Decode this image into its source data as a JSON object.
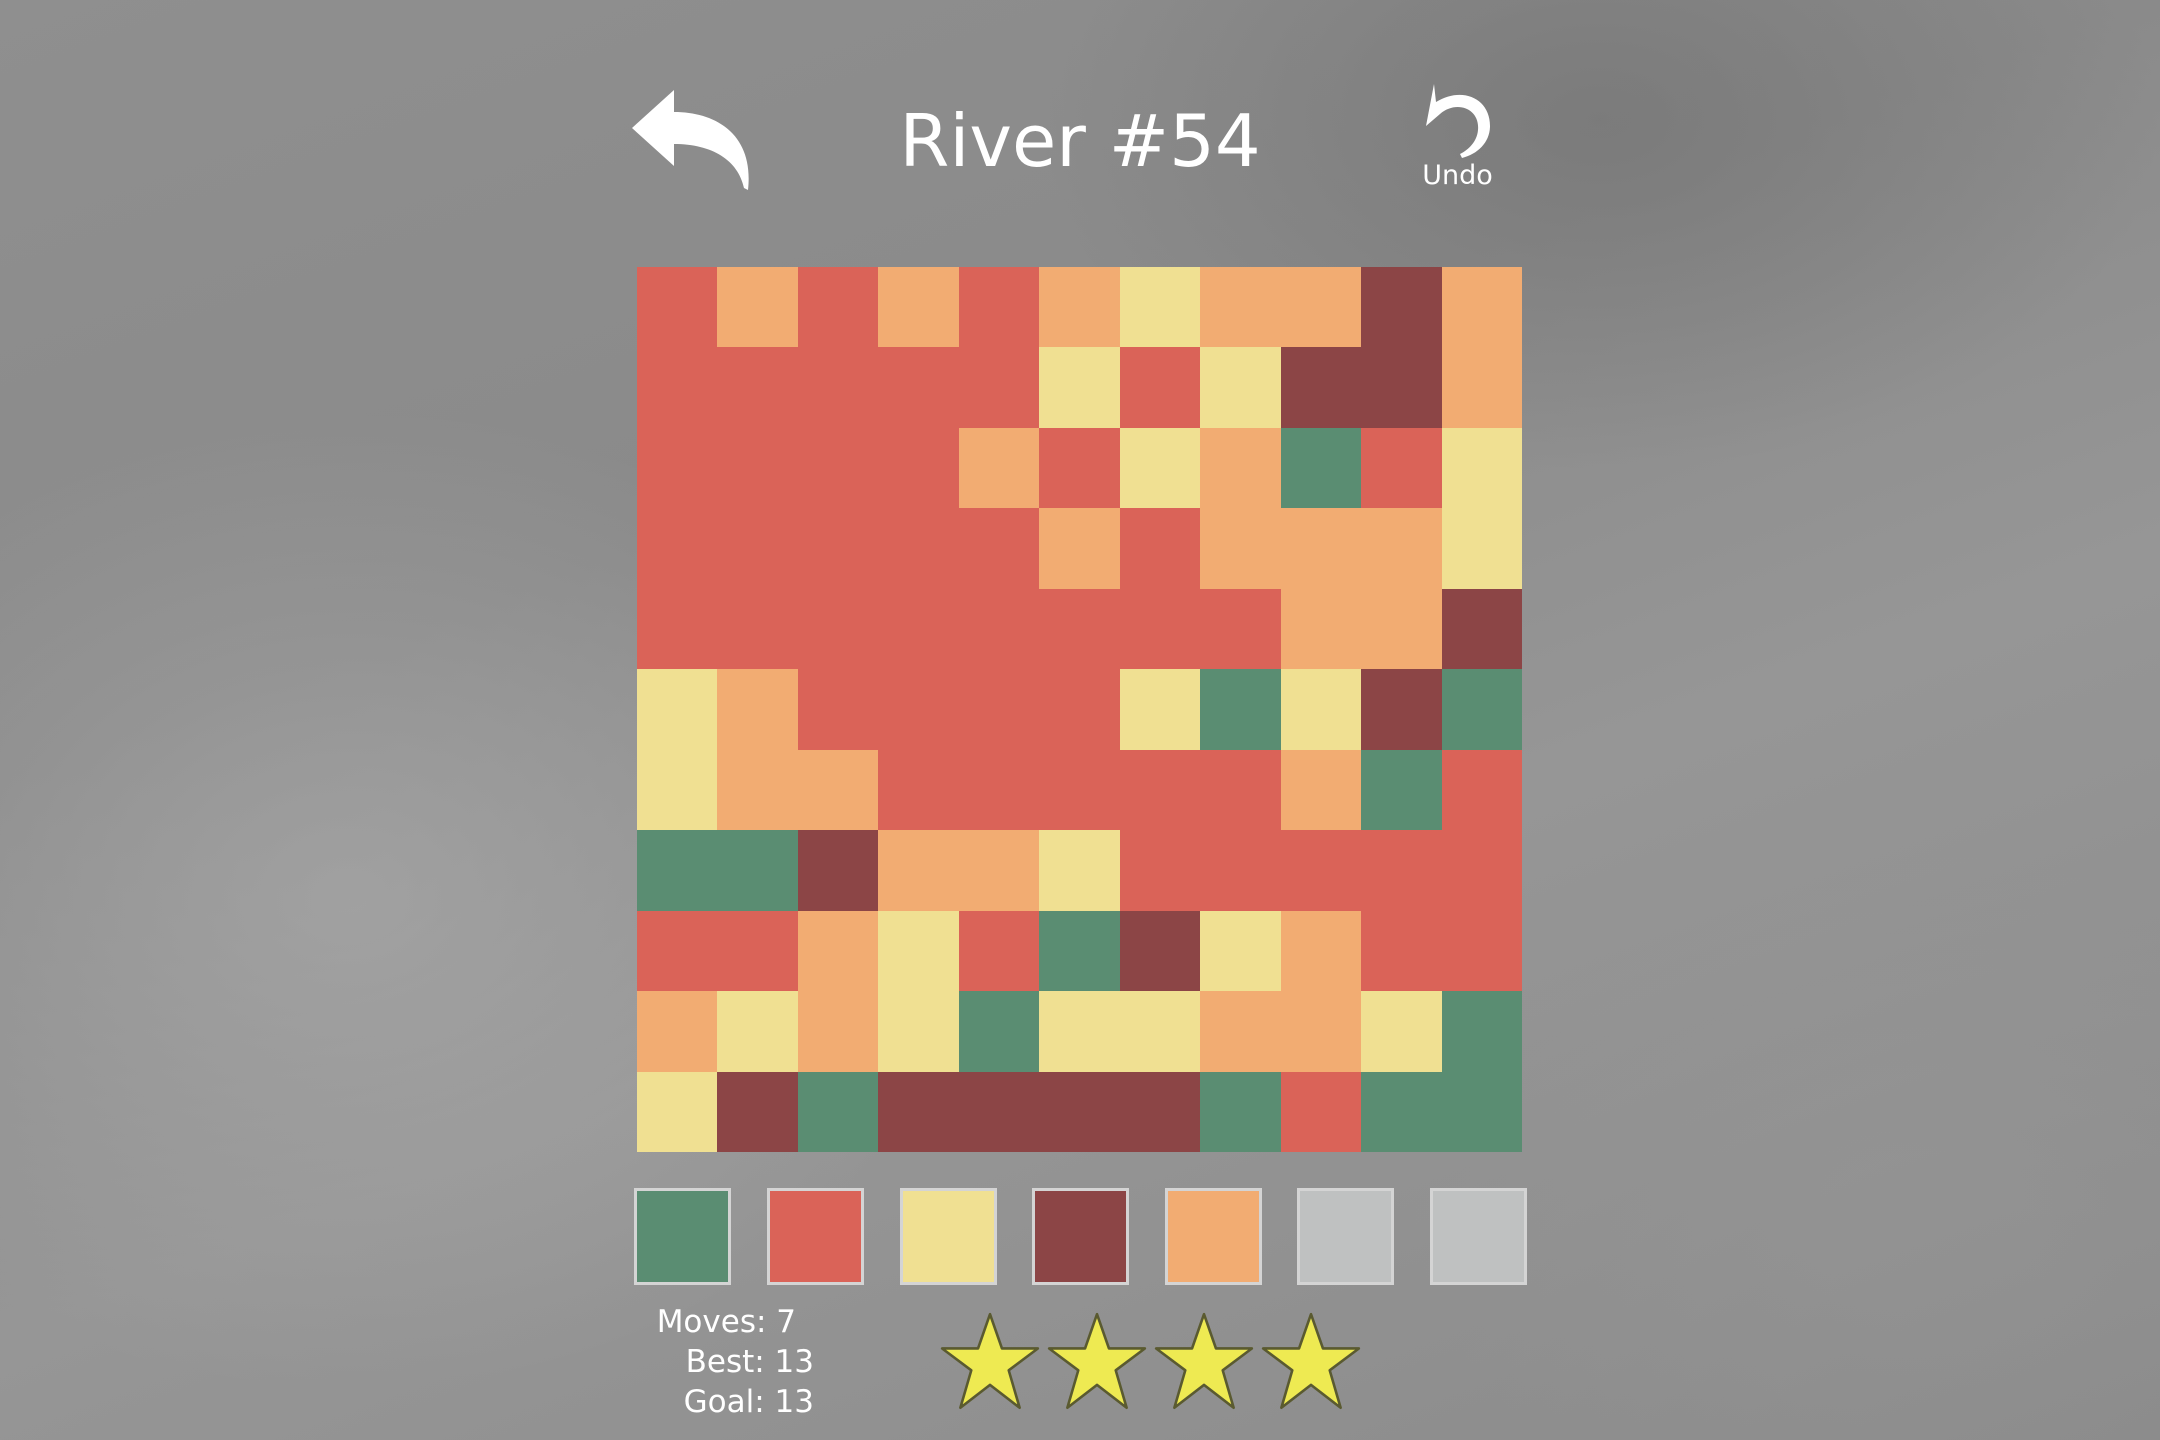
{
  "header": {
    "title": "River #54",
    "undo_label": "Undo",
    "back_icon": "back-arrow-icon",
    "undo_icon": "undo-arrow-icon"
  },
  "colors": {
    "G": "#5a8d72",
    "R": "#da6358",
    "Y": "#f0e092",
    "D": "#8c4546",
    "O": "#f2ac72",
    "E": "#bfc1c1",
    "star_fill": "#eeea52",
    "star_stroke": "#5a5a30"
  },
  "board": {
    "rows": [
      "ROROROYOODO",
      "RRRRRYRYDDO",
      "RRRRORYOGRY",
      "RRRRROROOOY",
      "RRRRRRRROOD",
      "YORRRRYGYDG",
      "YOORRRRROGR",
      "GGDOOYRRRRR",
      "RROYRGDYORR",
      "OYOYGYYOOYG",
      "YDGDDDDGRGG"
    ]
  },
  "palette": [
    {
      "color": "G",
      "label": "green"
    },
    {
      "color": "R",
      "label": "red"
    },
    {
      "color": "Y",
      "label": "yellow"
    },
    {
      "color": "D",
      "label": "dark-red"
    },
    {
      "color": "O",
      "label": "orange"
    },
    {
      "color": "E",
      "label": "empty"
    },
    {
      "color": "E",
      "label": "empty"
    }
  ],
  "stats": {
    "moves": "Moves: 7",
    "best": "Best: 13",
    "goal": "Goal: 13"
  },
  "rating": {
    "stars_earned": 4,
    "stars_total": 4,
    "icon": "star-icon"
  }
}
